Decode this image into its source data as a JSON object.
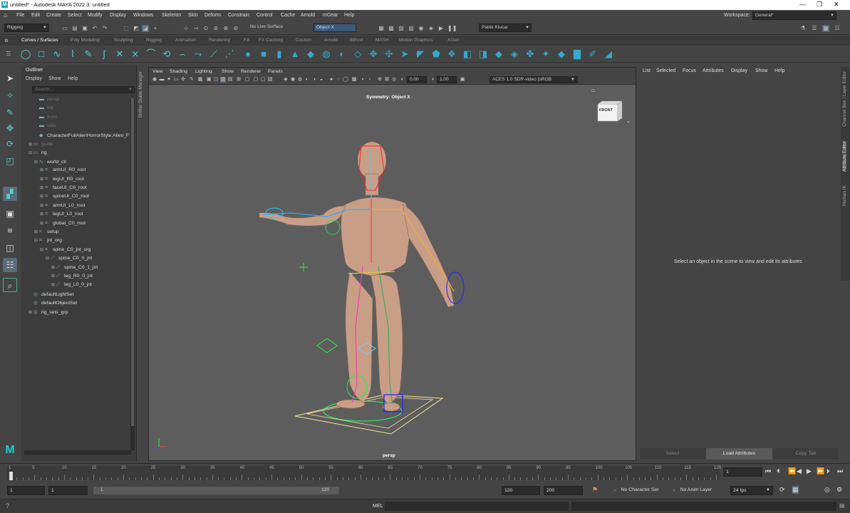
{
  "window": {
    "title": "untitled* - Autodesk MAYA 2022.3: untitled",
    "logo": "M"
  },
  "menubar": {
    "items": [
      "File",
      "Edit",
      "Create",
      "Select",
      "Modify",
      "Display",
      "Windows",
      "Skeleton",
      "Skin",
      "Deform",
      "Constrain",
      "Control",
      "Cache",
      "Arnold",
      "mGear",
      "Help"
    ],
    "workspace_label": "Workspace:",
    "workspace_value": "General*"
  },
  "statusline": {
    "mode": "Rigging",
    "live_surface": "No Live Surface",
    "symmetry": "Object X",
    "user": "Patrik Klucar"
  },
  "shelf": {
    "tabs": [
      "Curves / Surfaces",
      "Poly Modeling",
      "Sculpting",
      "Rigging",
      "Animation",
      "Rendering",
      "FX",
      "FX Caching",
      "Custom",
      "Arnold",
      "Bifrost",
      "MASH",
      "Motion Graphics",
      "XGen"
    ],
    "active_tab": "Curves / Surfaces"
  },
  "outliner": {
    "title": "Outliner",
    "menu": [
      "Display",
      "Show",
      "Help"
    ],
    "search_placeholder": "Search...",
    "items": [
      {
        "label": "persp",
        "indent": 1,
        "icon": "camera-icon",
        "dim": true
      },
      {
        "label": "top",
        "indent": 1,
        "icon": "camera-icon",
        "dim": true
      },
      {
        "label": "front",
        "indent": 1,
        "icon": "camera-icon",
        "dim": true
      },
      {
        "label": "side",
        "indent": 1,
        "icon": "camera-icon",
        "dim": true
      },
      {
        "label": "CharacterFullAlienHorrorStyle:Alien_F",
        "indent": 1,
        "icon": "mesh-icon",
        "dim": false
      },
      {
        "label": "guide",
        "indent": 0,
        "icon": "group-icon",
        "dim": true,
        "exp": "+"
      },
      {
        "label": "rig",
        "indent": 0,
        "icon": "group-icon",
        "dim": false,
        "exp": "-"
      },
      {
        "label": "world_ctl",
        "indent": 1,
        "icon": "curve-icon",
        "dim": false,
        "exp": "-"
      },
      {
        "label": "armUI_R0_root",
        "indent": 2,
        "icon": "transform-icon",
        "dim": false,
        "exp": "+"
      },
      {
        "label": "legUI_R0_root",
        "indent": 2,
        "icon": "transform-icon",
        "dim": false,
        "exp": "+"
      },
      {
        "label": "faceUI_C0_root",
        "indent": 2,
        "icon": "transform-icon",
        "dim": false,
        "exp": "+"
      },
      {
        "label": "spineUI_C0_root",
        "indent": 2,
        "icon": "transform-icon",
        "dim": false,
        "exp": "+"
      },
      {
        "label": "armUI_L0_root",
        "indent": 2,
        "icon": "transform-icon",
        "dim": false,
        "exp": "+"
      },
      {
        "label": "legUI_L0_root",
        "indent": 2,
        "icon": "transform-icon",
        "dim": false,
        "exp": "+"
      },
      {
        "label": "global_C0_root",
        "indent": 2,
        "icon": "transform-icon",
        "dim": false,
        "exp": "+"
      },
      {
        "label": "setup",
        "indent": 1,
        "icon": "transform-icon",
        "dim": false,
        "exp": "+"
      },
      {
        "label": "jnt_org",
        "indent": 1,
        "icon": "transform-icon",
        "dim": false,
        "exp": "-"
      },
      {
        "label": "spine_C0_jnt_org",
        "indent": 2,
        "icon": "transform-icon",
        "dim": false,
        "exp": "-"
      },
      {
        "label": "spine_C0_0_jnt",
        "indent": 3,
        "icon": "joint-icon",
        "dim": false,
        "exp": "-"
      },
      {
        "label": "spine_C0_1_jnt",
        "indent": 4,
        "icon": "joint-icon",
        "dim": false,
        "exp": "+"
      },
      {
        "label": "leg_R0_0_jnt",
        "indent": 4,
        "icon": "joint-icon",
        "dim": false,
        "exp": "+"
      },
      {
        "label": "leg_L0_0_jnt",
        "indent": 4,
        "icon": "joint-icon",
        "dim": false,
        "exp": "+"
      },
      {
        "label": "defaultLightSet",
        "indent": 0,
        "icon": "set-icon",
        "dim": false
      },
      {
        "label": "defaultObjectSet",
        "indent": 0,
        "icon": "set-icon",
        "dim": false
      },
      {
        "label": "rig_sets_grp",
        "indent": 0,
        "icon": "set-icon",
        "dim": false,
        "exp": "+"
      }
    ]
  },
  "side_tab": "Shifter Guide Manager",
  "viewport": {
    "menu": [
      "View",
      "Shading",
      "Lighting",
      "Show",
      "Renderer",
      "Panels"
    ],
    "exposure": "0.00",
    "gamma": "1.00",
    "color_space": "ACES 1.0 SDR-video (sRGB",
    "symmetry_label": "Symmetry: Object X",
    "camera": "persp",
    "viewcube": "FRONT"
  },
  "attribute_editor": {
    "menu": [
      "List",
      "Selected",
      "Focus",
      "Attributes",
      "Display",
      "Show",
      "Help"
    ],
    "message": "Select an object in the scene to view and edit its attributes",
    "buttons": [
      "Select",
      "Load Attributes",
      "Copy Tab"
    ]
  },
  "right_tabs": [
    "Channel Box / Layer Editor",
    "Attribute Editor",
    "Human IK"
  ],
  "timeline": {
    "ticks": [
      "1",
      "5",
      "10",
      "15",
      "20",
      "25",
      "30",
      "35",
      "40",
      "45",
      "50",
      "55",
      "60",
      "65",
      "70",
      "75",
      "80",
      "85",
      "90",
      "95",
      "100",
      "105",
      "110",
      "115",
      "120"
    ],
    "current_frame": "1"
  },
  "range": {
    "start": "1",
    "anim_start": "1",
    "range_start_label": "1",
    "range_end_label": "120",
    "anim_end": "120",
    "end": "200",
    "character_set": "No Character Set",
    "anim_layer": "No Anim Layer",
    "fps": "24 fps"
  },
  "cmdline": {
    "lang": "MEL"
  },
  "colors": {
    "bg": "#444444",
    "panel": "#3c3c3c",
    "viewport": "#5d5d5d",
    "accent": "#5a6b7a",
    "skin": "#c99e86"
  }
}
